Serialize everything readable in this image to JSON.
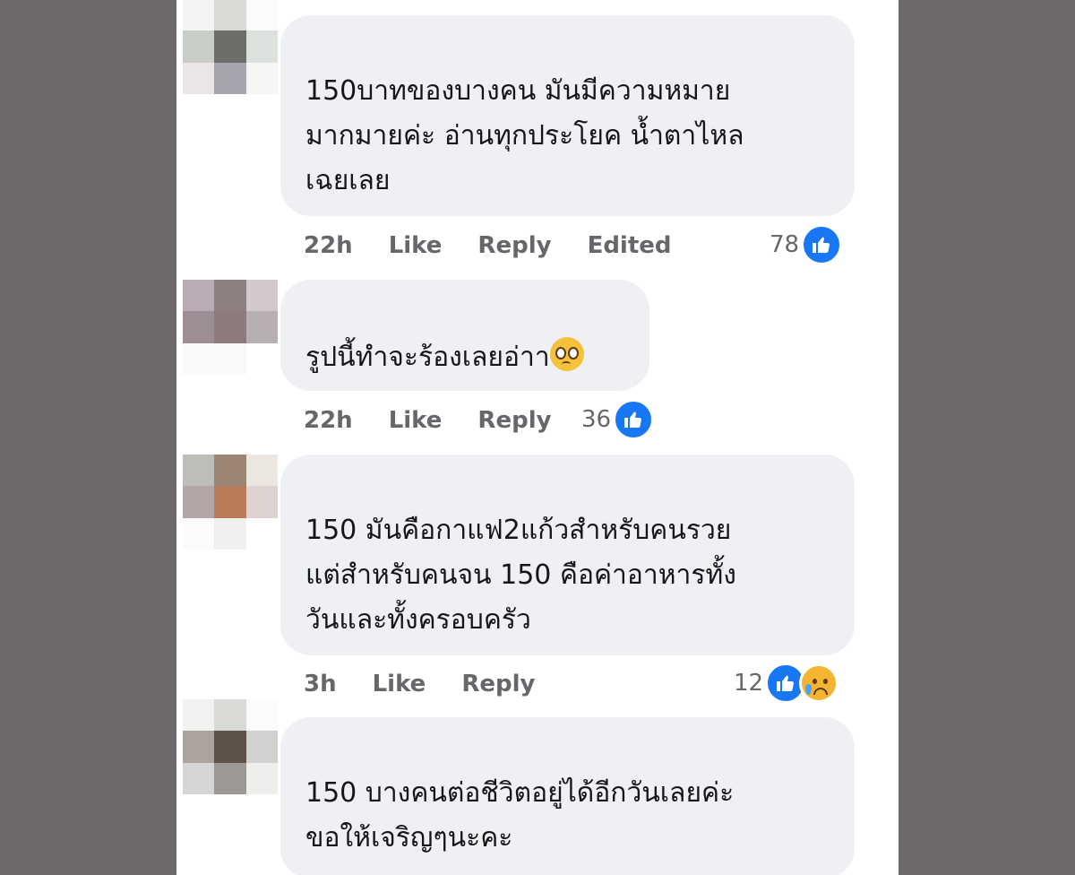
{
  "comments": [
    {
      "lines": [
        "150บาทของบางคน มันมีความหมาย",
        "มากมายค่ะ อ่านทุกประโยค น้ำตาไหล",
        "เฉยเลย"
      ],
      "time": "22h",
      "like": "Like",
      "reply": "Reply",
      "extra": "Edited",
      "reactions": {
        "count": "78",
        "icons": [
          "like-icon"
        ]
      }
    },
    {
      "lines": [
        "รูปนี้ทำจะร้องเลยอ่าา"
      ],
      "emoji": "pleading-face-emoji",
      "time": "22h",
      "like": "Like",
      "reply": "Reply",
      "reactions": {
        "count": "36",
        "icons": [
          "like-icon"
        ]
      }
    },
    {
      "lines": [
        "150 มันคือกาแฟ2แก้วสำหรับคนรวย",
        "แต่สำหรับคนจน 150 คือค่าอาหารทั้ง",
        "วันและทั้งครอบครัว"
      ],
      "time": "3h",
      "like": "Like",
      "reply": "Reply",
      "reactions": {
        "count": "12",
        "icons": [
          "like-icon",
          "sad-icon"
        ]
      }
    },
    {
      "lines": [
        "150 บางคนต่อชีวิตอยู่ได้อีกวันเลยค่ะ",
        "ขอให้เจริญๆนะคะ"
      ]
    }
  ],
  "colors": {
    "bubble": "#eef0f3",
    "meta_text": "#65676b",
    "like_blue": "#1877f2",
    "backdrop": "#6e6a6b"
  }
}
